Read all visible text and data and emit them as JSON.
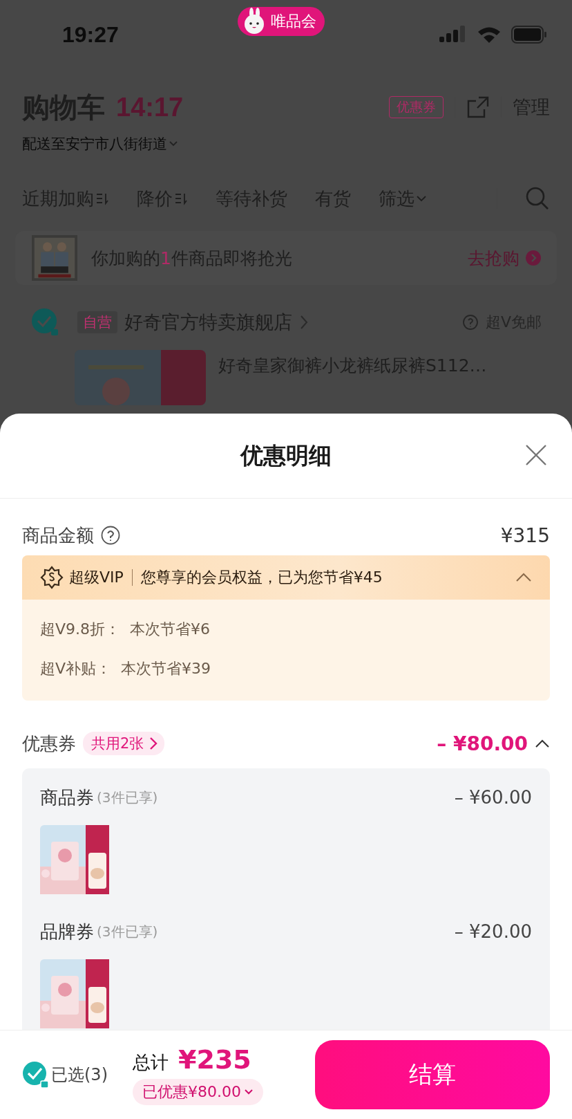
{
  "status_bar": {
    "time": "19:27",
    "app_badge": "唯品会"
  },
  "header": {
    "title": "购物车",
    "countdown": "14:17",
    "coupon_tag": "优惠券",
    "manage": "管理",
    "address": "配送至安宁市八街街道"
  },
  "filters": [
    {
      "label": "近期加购",
      "kind": "sort"
    },
    {
      "label": "降价",
      "kind": "sort"
    },
    {
      "label": "等待补货",
      "kind": "plain"
    },
    {
      "label": "有货",
      "kind": "plain"
    },
    {
      "label": "筛选",
      "kind": "dropdown"
    }
  ],
  "banner": {
    "text": "你加购的**1**件商品即将抢光",
    "action": "去抢购"
  },
  "store": {
    "checked": true,
    "tag": "自营",
    "name": "好奇官方特卖旗舰店",
    "shipping": "超V免邮"
  },
  "product": {
    "title": "好奇皇家御裤小龙裤纸尿裤S112…"
  },
  "sheet": {
    "title": "优惠明细",
    "goods_amount": {
      "label": "商品金额",
      "value": "¥315"
    },
    "vip": {
      "badge": "超级VIP",
      "summary": "您尊享的会员权益，已为您节省¥45",
      "expanded": true,
      "items": [
        {
          "label": "超V9.8折：",
          "value": "本次节省¥6"
        },
        {
          "label": "超V补贴：",
          "value": "本次节省¥39"
        }
      ]
    },
    "coupons": {
      "label": "优惠券",
      "tag": "共用2张",
      "value": "– ¥80.00",
      "expanded": true,
      "items": [
        {
          "name": "商品券",
          "note": "(3件已享)",
          "value": "– ¥60.00"
        },
        {
          "name": "品牌券",
          "note": "(3件已享)",
          "value": "– ¥20.00"
        }
      ]
    }
  },
  "footer": {
    "checked": true,
    "selected_label": "已选(3)",
    "total_label": "总计",
    "total": "¥235",
    "discount": "已优惠¥80.00",
    "checkout": "结算"
  }
}
